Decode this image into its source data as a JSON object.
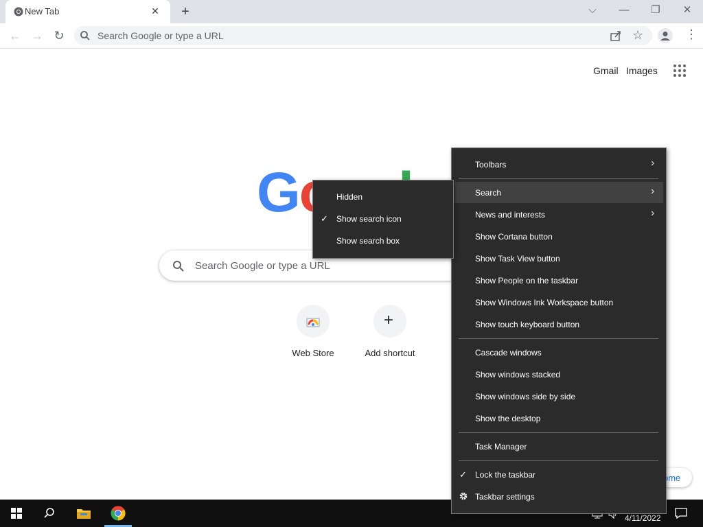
{
  "browser": {
    "tab_title": "New Tab",
    "tab_close": "✕",
    "new_tab": "+",
    "win_dropdown": "⌵",
    "win_min": "—",
    "win_restore": "❐",
    "win_close": "✕",
    "omnibox_placeholder": "Search Google or type a URL"
  },
  "google": {
    "gmail": "Gmail",
    "images": "Images",
    "logo": "Google",
    "search_placeholder": "Search Google or type a URL",
    "shortcuts": [
      {
        "label": "Web Store"
      },
      {
        "label": "Add shortcut"
      }
    ],
    "customize_label": "ome"
  },
  "context_menu": {
    "group1": [
      "Toolbars",
      "Search",
      "News and interests",
      "Show Cortana button",
      "Show Task View button",
      "Show People on the taskbar",
      "Show Windows Ink Workspace button",
      "Show touch keyboard button"
    ],
    "group2": [
      "Cascade windows",
      "Show windows stacked",
      "Show windows side by side",
      "Show the desktop"
    ],
    "group3": [
      "Task Manager"
    ],
    "group4": [
      "Lock the taskbar",
      "Taskbar settings"
    ]
  },
  "search_submenu": {
    "items": [
      "Hidden",
      "Show search icon",
      "Show search box"
    ],
    "checked_index": 1
  },
  "taskbar": {
    "date": "4/11/2022"
  },
  "colors": {
    "google_blue": "#4285f4",
    "google_red": "#ea4335",
    "google_yellow": "#fbbc05",
    "google_green": "#34a853",
    "menu_bg": "#2b2b2b",
    "menu_highlight": "#414141"
  }
}
